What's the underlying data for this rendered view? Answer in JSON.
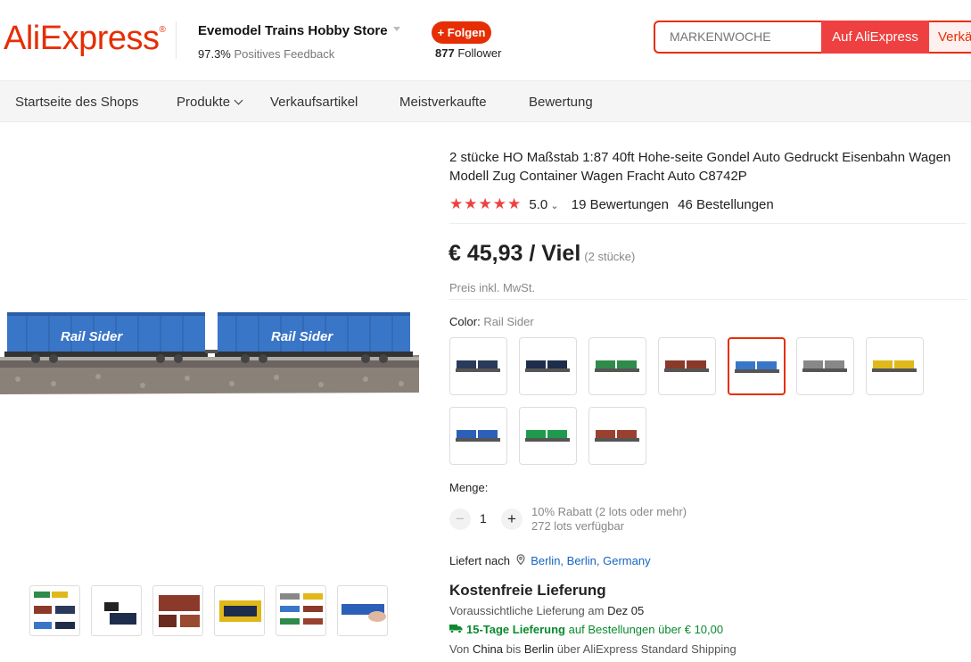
{
  "header": {
    "logo": "AliExpress",
    "store_name": "Evemodel Trains Hobby Store",
    "feedback_pct": "97.3%",
    "feedback_label": "Positives Feedback",
    "follow_label": "+ Folgen",
    "follower_count": "877",
    "follower_label": "Follower",
    "search_placeholder": "MARKENWOCHE",
    "search_aliexpress": "Auf AliExpress",
    "search_store": "Verkäufer"
  },
  "nav": {
    "items": [
      "Startseite des Shops",
      "Produkte",
      "Verkaufsartikel",
      "Meistverkaufte",
      "Bewertung"
    ]
  },
  "product": {
    "title": "2 stücke HO Maßstab 1:87 40ft Hohe-seite Gondel Auto Gedruckt Eisenbahn Wagen Modell Zug Container Wagen Fracht Auto C8742P",
    "rating_value": "5.0",
    "reviews": "19 Bewertungen",
    "orders": "46 Bestellungen",
    "price": "€ 45,93 / Viel",
    "price_unit": "(2 stücke)",
    "vat_note": "Preis inkl. MwSt.",
    "image_brand_text": "Rail Sider",
    "color_label": "Color:",
    "color_value": "Rail Sider",
    "colors": [
      {
        "name": "dark-navy-wagon",
        "color": "#2a3a5a"
      },
      {
        "name": "navy-wagon-parts",
        "color": "#1f2d4d"
      },
      {
        "name": "green-container",
        "color": "#2e8b4a"
      },
      {
        "name": "brown-container",
        "color": "#8b3a2a"
      },
      {
        "name": "blue-rail-sider",
        "color": "#3a76c8"
      },
      {
        "name": "grey-container",
        "color": "#888888"
      },
      {
        "name": "yellow-container",
        "color": "#e0b81a"
      },
      {
        "name": "blue-container",
        "color": "#2c5fb8"
      },
      {
        "name": "green-container-2",
        "color": "#1e9a4c"
      },
      {
        "name": "rust-container",
        "color": "#9a4030"
      }
    ],
    "quantity_label": "Menge:",
    "quantity_value": "1",
    "discount_note": "10% Rabatt (2 lots oder mehr)",
    "stock_note": "272 lots verfügbar"
  },
  "shipping": {
    "ship_to_label": "Liefert nach",
    "ship_to_location": "Berlin, Berlin, Germany",
    "free_shipping": "Kostenfreie Lieferung",
    "estimated_label": "Voraussichtliche Lieferung am",
    "estimated_date": "Dez 05",
    "fast_label": "15-Tage Lieferung",
    "fast_condition": "auf Bestellungen über € 10,00",
    "from_word": "Von",
    "from_country": "China",
    "to_word": "bis",
    "to_city": "Berlin",
    "via": "über AliExpress Standard Shipping"
  }
}
